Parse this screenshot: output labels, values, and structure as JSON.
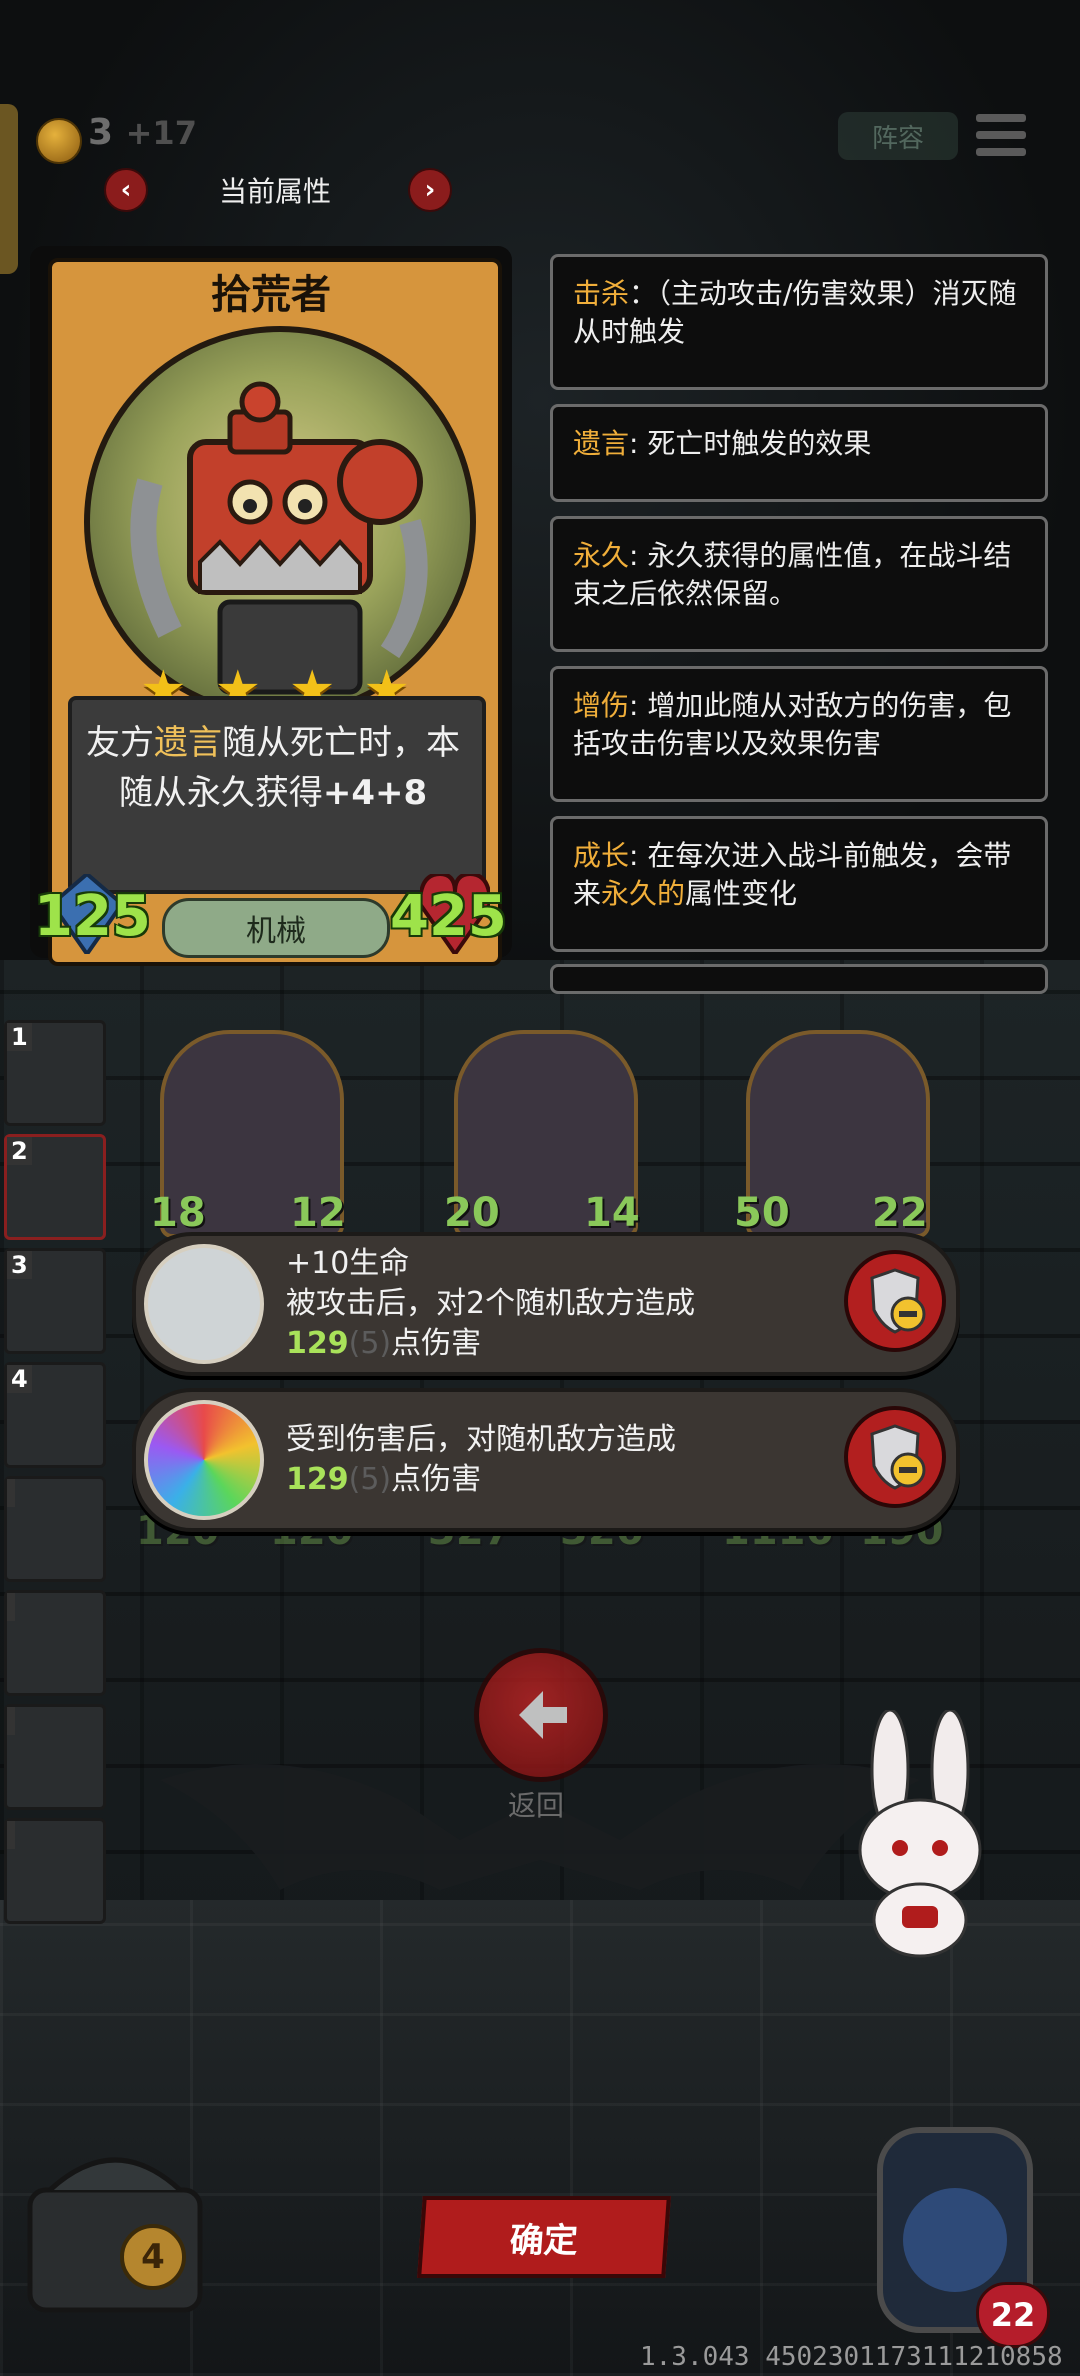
{
  "top_bar": {
    "coins": "3",
    "coin_income": "+17",
    "lineup_label": "阵容",
    "menu_icon": "hamburger-icon"
  },
  "attribute_nav": {
    "title": "当前属性",
    "prev": "‹",
    "next": "›"
  },
  "card": {
    "name": "拾荒者",
    "stars": 4,
    "desc_prefix": "友方",
    "desc_keyword": "遗言",
    "desc_mid": "随从死亡时，本随从永久获得",
    "desc_bold": "+4+8",
    "attack": "125",
    "health": "425",
    "tribe": "机械"
  },
  "keywords": [
    {
      "keyword": "击杀",
      "text": "：（主动攻击/伤害效果）消灭随从时触发"
    },
    {
      "keyword": "遗言",
      "text": ": 死亡时触发的效果"
    },
    {
      "keyword": "永久",
      "text": ": 永久获得的属性值，在战斗结束之后依然保留。"
    },
    {
      "keyword": "增伤",
      "text": ": 增加此随从对敌方的伤害，包括攻击伤害以及效果伤害"
    },
    {
      "keyword": "成长",
      "text": ": 在每次进入战斗前触发，会带来",
      "highlight": "永久的",
      "text_after": "属性变化"
    }
  ],
  "roster": [
    {
      "num": "1"
    },
    {
      "num": "2"
    },
    {
      "num": "3"
    },
    {
      "num": "4"
    },
    {
      "num": ""
    },
    {
      "num": ""
    },
    {
      "num": ""
    },
    {
      "num": ""
    }
  ],
  "board": {
    "top_row": [
      {
        "atk": "18",
        "hp": "12"
      },
      {
        "atk": "20",
        "hp": "14"
      },
      {
        "atk": "50",
        "hp": "22"
      }
    ],
    "bottom_row": [
      {
        "atk": "120",
        "hp": "120"
      },
      {
        "atk": "327",
        "hp": "326"
      },
      {
        "atk": "1116",
        "hp": "190"
      }
    ]
  },
  "effects": [
    {
      "line1": "+10生命",
      "line2": "被攻击后，对2个随机敌方造成",
      "damage": "129",
      "damage_base": "(5)",
      "damage_suffix": "点伤害",
      "icon": "jester-icon"
    },
    {
      "line1": "",
      "line2": "受到伤害后，对随机敌方造成",
      "damage": "129",
      "damage_base": "(5)",
      "damage_suffix": "点伤害",
      "icon": "prism-crystal-icon"
    }
  ],
  "back": {
    "label": "返回",
    "icon": "arrow-left-icon"
  },
  "confirm_label": "确定",
  "chest_count": "4",
  "hero_health": "22",
  "version": "1.3.043 4502301173111210858",
  "colors": {
    "keyword": "#f0ae3a",
    "stat_green": "#9ee34a",
    "button_red": "#b01c1c",
    "card_gold": "#d6953d"
  }
}
